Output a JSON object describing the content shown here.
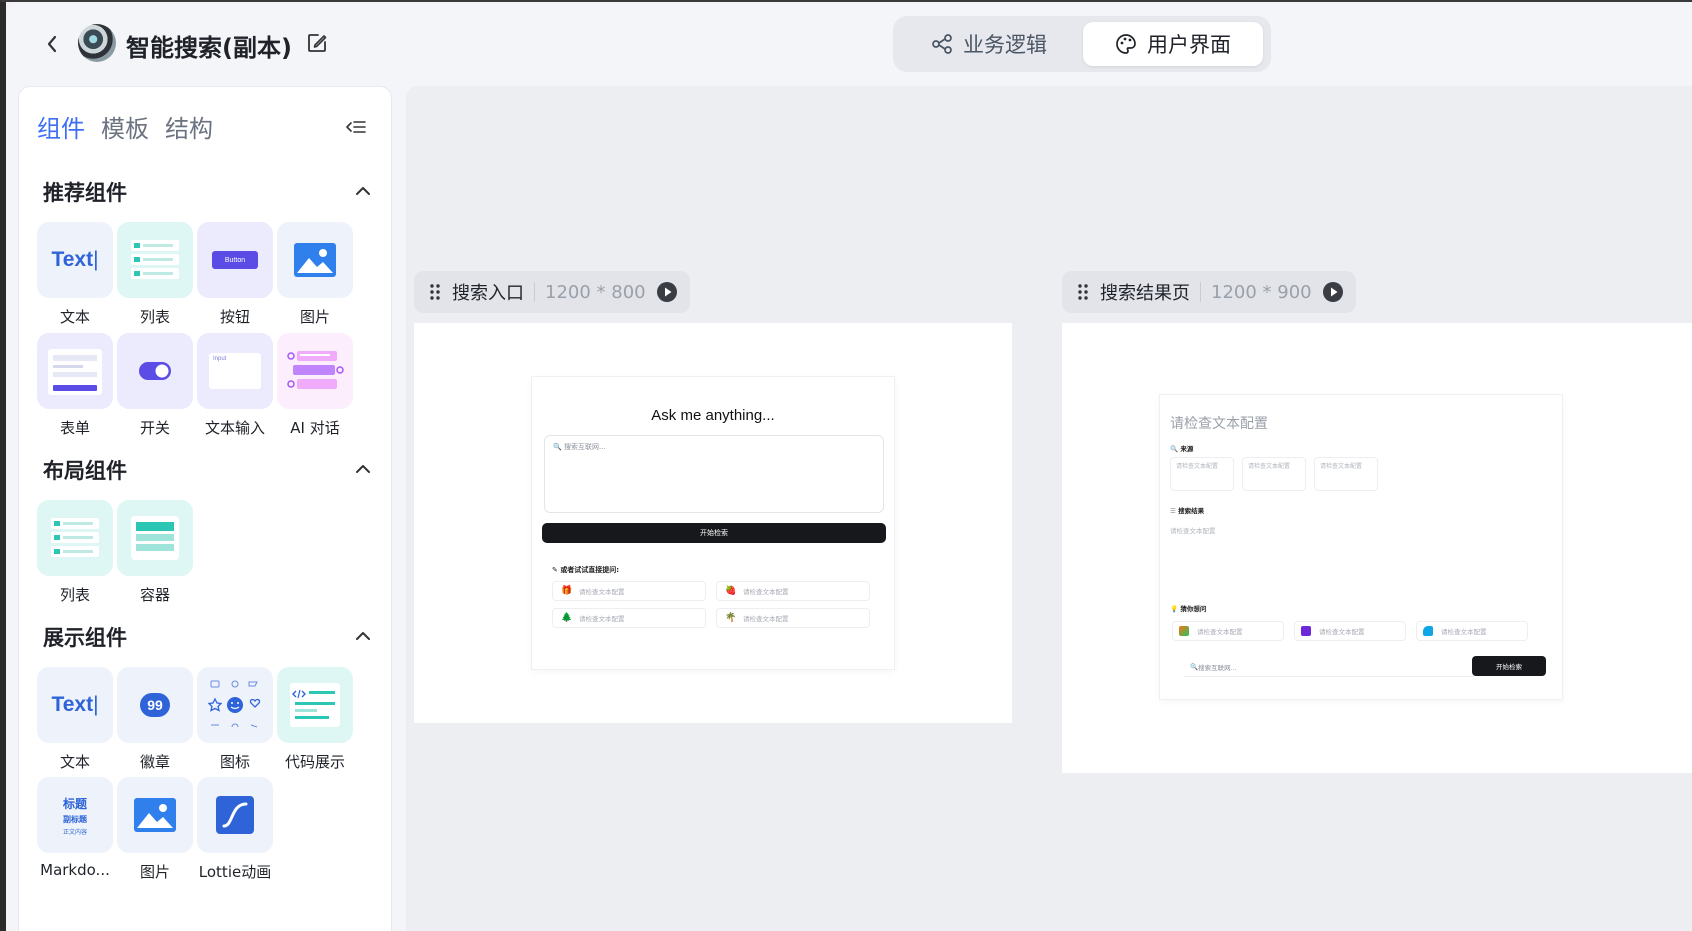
{
  "header": {
    "title": "智能搜索(副本)",
    "modes": [
      {
        "label": "业务逻辑",
        "active": false
      },
      {
        "label": "用户界面",
        "active": true
      }
    ]
  },
  "panel": {
    "tabs": [
      "组件",
      "模板",
      "结构"
    ],
    "active_tab": "组件",
    "sections": [
      {
        "title": "推荐组件",
        "items": [
          "文本",
          "列表",
          "按钮",
          "图片",
          "表单",
          "开关",
          "文本输入",
          "AI 对话"
        ]
      },
      {
        "title": "布局组件",
        "items": [
          "列表",
          "容器"
        ]
      },
      {
        "title": "展示组件",
        "items": [
          "文本",
          "徽章",
          "图标",
          "代码展示",
          "Markdo...",
          "图片",
          "Lottie动画"
        ]
      }
    ],
    "tile_text": "Text",
    "tile_button": "Button",
    "tile_input": "Input",
    "tile_badge": "99",
    "tile_md": {
      "title": "标题",
      "subtitle": "副标题",
      "body": "正文内容"
    }
  },
  "canvas": {
    "pages": [
      {
        "name": "搜索入口",
        "size": "1200 * 800",
        "content": {
          "heading": "Ask me anything...",
          "search_placeholder": "搜索互联网...",
          "start_button": "开始检索",
          "try_label": "或者试试直接提问:",
          "suggestions": [
            {
              "emoji": "🎁",
              "text": "请检查文本配置"
            },
            {
              "emoji": "🍓",
              "text": "请检查文本配置"
            },
            {
              "emoji": "🌲",
              "text": "请检查文本配置"
            },
            {
              "emoji": "🌴",
              "text": "请检查文本配置"
            }
          ]
        }
      },
      {
        "name": "搜索结果页",
        "size": "1200 * 900",
        "content": {
          "title": "请检查文本配置",
          "sources_label": "来源",
          "source_cards": [
            "请检查文本配置",
            "请检查文本配置",
            "请检查文本配置"
          ],
          "results_label": "搜索结果",
          "results_text": "请检查文本配置",
          "guess_label": "猜你想问",
          "guesses": [
            "请检查文本配置",
            "请检查文本配置",
            "请检查文本配置"
          ],
          "search_placeholder": "搜索互联网...",
          "start_button": "开始检索"
        }
      }
    ]
  },
  "colors": {
    "accent": "#3b6ff5",
    "canvas_bg": "#eceef2",
    "dark_button": "#16181c",
    "teal_tile": "#dff7f4",
    "lavender_tile": "#eceafd"
  }
}
